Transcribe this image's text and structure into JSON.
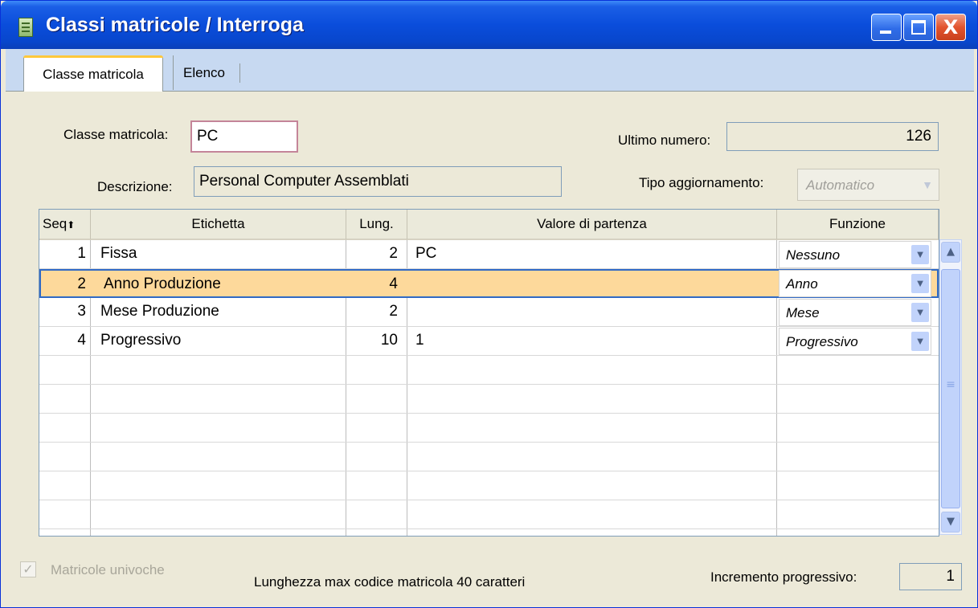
{
  "window": {
    "title": "Classi matricole / Interroga",
    "minimize": "",
    "maximize": "",
    "close": "X"
  },
  "tabs": [
    {
      "label": "Classe matricola",
      "active": true
    },
    {
      "label": "Elenco",
      "active": false
    }
  ],
  "form": {
    "classe_label": "Classe matricola:",
    "classe_value": "PC",
    "descrizione_label": "Descrizione:",
    "descrizione_value": "Personal Computer Assemblati",
    "ultimo_label": "Ultimo numero:",
    "ultimo_value": "126",
    "tipo_label": "Tipo aggiornamento:",
    "tipo_value": "Automatico"
  },
  "grid": {
    "headers": {
      "seq": "Seq",
      "etichetta": "Etichetta",
      "lung": "Lung.",
      "valore": "Valore di partenza",
      "funzione": "Funzione"
    },
    "rows": [
      {
        "seq": "1",
        "etichetta": "Fissa",
        "lung": "2",
        "valore": "PC",
        "funzione": "Nessuno"
      },
      {
        "seq": "2",
        "etichetta": "Anno Produzione",
        "lung": "4",
        "valore": "",
        "funzione": "Anno",
        "selected": true
      },
      {
        "seq": "3",
        "etichetta": "Mese Produzione",
        "lung": "2",
        "valore": "",
        "funzione": "Mese"
      },
      {
        "seq": "4",
        "etichetta": "Progressivo",
        "lung": "10",
        "valore": "1",
        "funzione": "Progressivo"
      }
    ]
  },
  "footer": {
    "univoche_label": "Matricole univoche",
    "univoche_checked": true,
    "lunghezza_text": "Lunghezza max codice matricola 40 caratteri",
    "incremento_label": "Incremento progressivo:",
    "incremento_value": "1"
  }
}
